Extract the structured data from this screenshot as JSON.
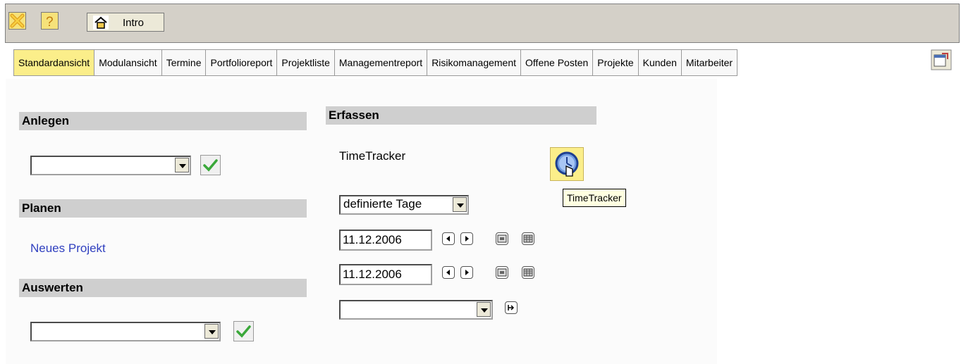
{
  "toolbar": {
    "close_icon": "close-x-icon",
    "help_icon": "question-icon",
    "home_icon": "house-icon",
    "intro_label": "Intro"
  },
  "tabs": [
    {
      "label": "Standardansicht",
      "active": true
    },
    {
      "label": "Modulansicht",
      "active": false
    },
    {
      "label": "Termine",
      "active": false
    },
    {
      "label": "Portfolioreport",
      "active": false
    },
    {
      "label": "Projektliste",
      "active": false
    },
    {
      "label": "Managementreport",
      "active": false
    },
    {
      "label": "Risikomanagement",
      "active": false
    },
    {
      "label": "Offene Posten",
      "active": false
    },
    {
      "label": "Projekte",
      "active": false
    },
    {
      "label": "Kunden",
      "active": false
    },
    {
      "label": "Mitarbeiter",
      "active": false
    }
  ],
  "left": {
    "anlegen": {
      "title": "Anlegen",
      "select_value": ""
    },
    "planen": {
      "title": "Planen",
      "link": "Neues Projekt"
    },
    "auswerten": {
      "title": "Auswerten",
      "select_value": ""
    }
  },
  "erfassen": {
    "title": "Erfassen",
    "timetracker_label": "TimeTracker",
    "tooltip": "TimeTracker",
    "range_select": "definierte Tage",
    "date_from": "11.12.2006",
    "date_to": "11.12.2006",
    "extra_select": ""
  },
  "colors": {
    "active_tab": "#fbee8a",
    "section_bar": "#cfcfcf",
    "link": "#2f3fbf",
    "check": "#3aa83a"
  }
}
